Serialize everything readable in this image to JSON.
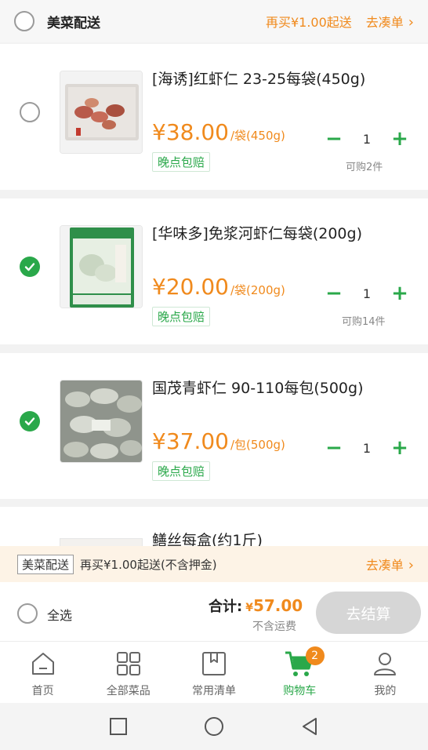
{
  "store": {
    "name": "美菜配送",
    "min_order_text": "再买¥1.00起送",
    "go_add_label": "去凑单"
  },
  "items": [
    {
      "title": "[海诱]红虾仁 23-25每袋(450g)",
      "price": "¥38.00",
      "unit": "/袋(450g)",
      "badge": "晚点包赔",
      "qty": "1",
      "limit": "可购2件",
      "selected": false
    },
    {
      "title": "[华味多]免浆河虾仁每袋(200g)",
      "price": "¥20.00",
      "unit": "/袋(200g)",
      "badge": "晚点包赔",
      "qty": "1",
      "limit": "可购14件",
      "selected": true
    },
    {
      "title": "国茂青虾仁 90-110每包(500g)",
      "price": "¥37.00",
      "unit": "/包(500g)",
      "badge": "晚点包赔",
      "qty": "1",
      "limit": "",
      "selected": true
    },
    {
      "title": "鳝丝每盒(约1斤)"
    }
  ],
  "notice": {
    "tag": "美菜配送",
    "message": "再买¥1.00起送(不含押金)",
    "go_label": "去凑单"
  },
  "checkout": {
    "select_all_label": "全选",
    "total_label": "合计:",
    "currency": "¥",
    "total_amount": "57.00",
    "fee_note": "不含运费",
    "pay_label": "去结算"
  },
  "tabs": [
    {
      "label": "首页",
      "icon": "home-icon"
    },
    {
      "label": "全部菜品",
      "icon": "grid-icon"
    },
    {
      "label": "常用清单",
      "icon": "bookmark-list-icon"
    },
    {
      "label": "购物车",
      "icon": "cart-icon",
      "badge": "2",
      "active": true
    },
    {
      "label": "我的",
      "icon": "person-icon"
    }
  ],
  "colors": {
    "accent_orange": "#f08a1d",
    "accent_green": "#2aa84a",
    "disabled_button": "#d6d6d6"
  }
}
